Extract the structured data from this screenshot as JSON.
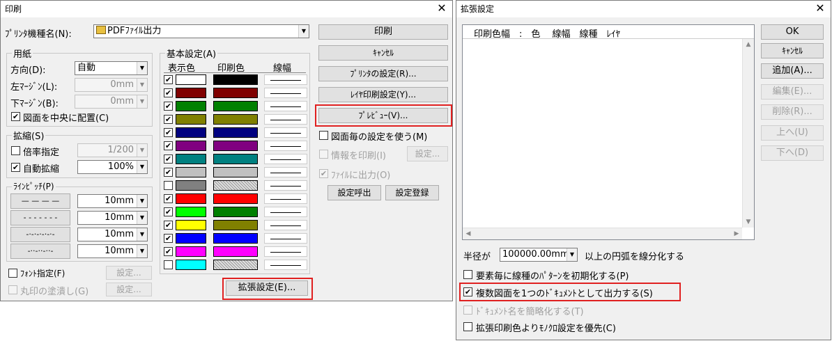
{
  "print_dialog": {
    "title": "印刷",
    "printer_label": "ﾌﾟﾘﾝﾀ機種名(N):",
    "printer_value": "PDFﾌｧｲﾙ出力",
    "paper": {
      "group": "用紙",
      "orientation_label": "方向(D):",
      "orientation_value": "自動",
      "left_margin_label": "左ﾏｰｼﾞﾝ(L):",
      "left_margin_value": "0mm",
      "bottom_margin_label": "下ﾏｰｼﾞﾝ(B):",
      "bottom_margin_value": "0mm",
      "center_label": "図面を中央に配置(C)",
      "center_checked": true
    },
    "scale": {
      "group": "拡縮(S)",
      "ratio_label": "倍率指定",
      "ratio_checked": false,
      "ratio_value": "1/200",
      "auto_label": "自動拡縮",
      "auto_checked": true,
      "auto_value": "100%"
    },
    "pitch": {
      "group": "ﾗｲﾝﾋﾟｯﾁ(P)",
      "rows": [
        {
          "style": "— — — —",
          "value": "10mm"
        },
        {
          "style": "- - - - - - -",
          "value": "10mm"
        },
        {
          "style": "-·-·-·-·-·-",
          "value": "10mm"
        },
        {
          "style": "-··-··-··-",
          "value": "10mm"
        }
      ]
    },
    "font_label": "ﾌｫﾝﾄ指定(F)",
    "font_checked": false,
    "font_settings": "設定...",
    "circle_label": "丸印の塗潰し(G)",
    "circle_settings": "設定...",
    "basic": {
      "group": "基本設定(A)",
      "col_display": "表示色",
      "col_print": "印刷色",
      "col_width": "線幅",
      "rows": [
        {
          "checked": true,
          "display": "#ffffff",
          "print": "#000000",
          "hatch": false
        },
        {
          "checked": true,
          "display": "#800000",
          "print": "#800000",
          "hatch": false
        },
        {
          "checked": true,
          "display": "#008000",
          "print": "#008000",
          "hatch": false
        },
        {
          "checked": true,
          "display": "#808000",
          "print": "#808000",
          "hatch": false
        },
        {
          "checked": true,
          "display": "#000080",
          "print": "#000080",
          "hatch": false
        },
        {
          "checked": true,
          "display": "#800080",
          "print": "#800080",
          "hatch": false
        },
        {
          "checked": true,
          "display": "#008080",
          "print": "#008080",
          "hatch": false
        },
        {
          "checked": true,
          "display": "#c0c0c0",
          "print": "#c0c0c0",
          "hatch": false
        },
        {
          "checked": false,
          "display": "#808080",
          "print": "#808080",
          "hatch": true
        },
        {
          "checked": true,
          "display": "#ff0000",
          "print": "#ff0000",
          "hatch": false
        },
        {
          "checked": true,
          "display": "#00ff00",
          "print": "#008000",
          "hatch": false
        },
        {
          "checked": true,
          "display": "#ffff00",
          "print": "#808000",
          "hatch": false
        },
        {
          "checked": true,
          "display": "#0000ff",
          "print": "#0000ff",
          "hatch": false
        },
        {
          "checked": true,
          "display": "#ff00ff",
          "print": "#ff00ff",
          "hatch": false
        },
        {
          "checked": false,
          "display": "#00ffff",
          "print": "#00c0c0",
          "hatch": true
        }
      ]
    },
    "extended_button": "拡張設定(E)...",
    "buttons": {
      "print": "印刷",
      "cancel": "ｷｬﾝｾﾙ",
      "printer_settings": "ﾌﾟﾘﾝﾀの設定(R)...",
      "layer_print": "ﾚｲﾔ印刷設定(Y)...",
      "preview": "ﾌﾟﾚﾋﾞｭｰ(V)..."
    },
    "per_drawing_label": "図面毎の設定を使う(M)",
    "per_drawing_checked": false,
    "print_info_label": "情報を印刷(I)",
    "print_info_settings": "設定...",
    "file_output_label": "ﾌｧｲﾙに出力(O)",
    "file_output_checked": true,
    "load_settings": "設定呼出",
    "save_settings": "設定登録"
  },
  "ext_dialog": {
    "title": "拡張設定",
    "list_header": "印刷色幅　:　色　 線幅　線種　ﾚｲﾔ",
    "radius_label": "半径が",
    "radius_value": "100000.00mm",
    "radius_suffix": "以上の円弧を線分化する",
    "opt1_label": "要素毎に線種のﾊﾟﾀｰﾝを初期化する(P)",
    "opt1_checked": false,
    "opt2_label": "複数図面を1つのﾄﾞｷｭﾒﾝﾄとして出力する(S)",
    "opt2_checked": true,
    "opt3_label": "ﾄﾞｷｭﾒﾝﾄ名を簡略化する(T)",
    "opt3_checked": false,
    "opt4_label": "拡張印刷色よりﾓﾉｸﾛ設定を優先(C)",
    "opt4_checked": false,
    "buttons": {
      "ok": "OK",
      "cancel": "ｷｬﾝｾﾙ",
      "add": "追加(A)...",
      "edit": "編集(E)...",
      "delete": "削除(R)...",
      "up": "上へ(U)",
      "down": "下へ(D)"
    }
  }
}
